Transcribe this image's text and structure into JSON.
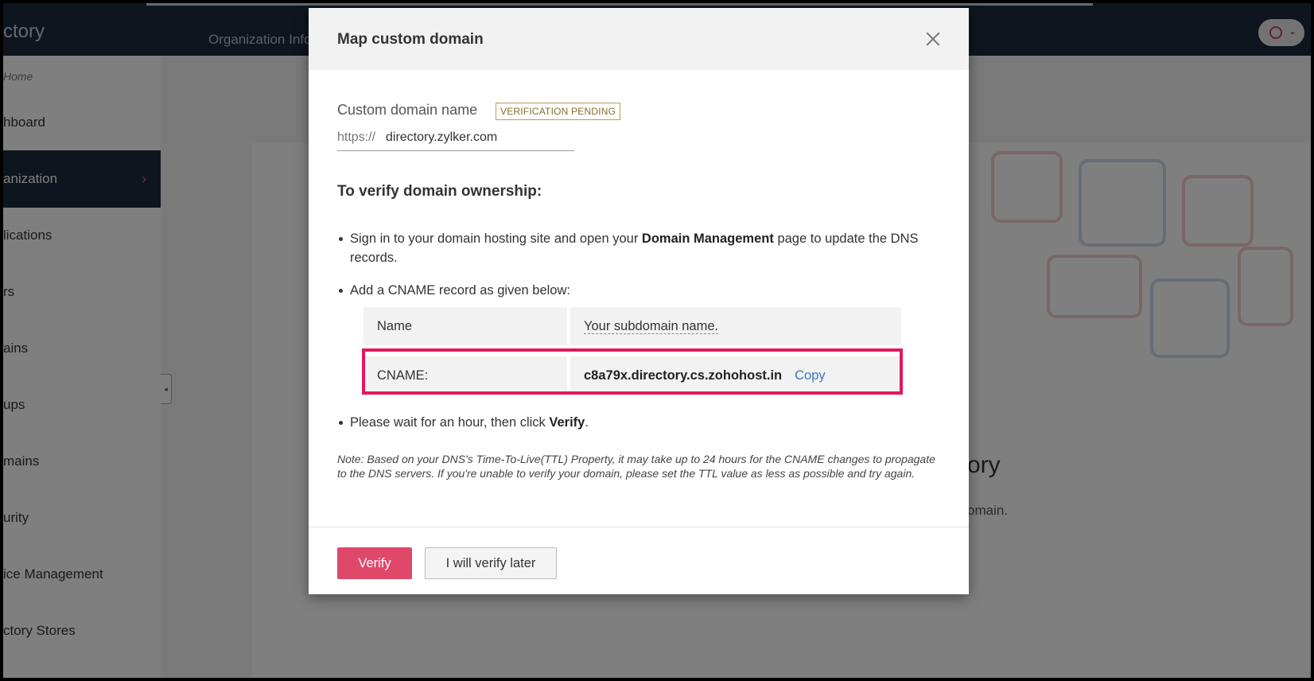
{
  "app": {
    "brand_fragment": "ctory",
    "top_nav_fragment": "Organization Info"
  },
  "sidebar": {
    "breadcrumb_fragment": "Home",
    "items": [
      {
        "label": "hboard"
      },
      {
        "label": "anization",
        "active": true
      },
      {
        "label": "lications"
      },
      {
        "label": "rs"
      },
      {
        "label": "ains"
      },
      {
        "label": "ups"
      },
      {
        "label": "mains"
      },
      {
        "label": "urity"
      },
      {
        "label": "ice Management"
      },
      {
        "label": "ctory Stores"
      }
    ]
  },
  "background_content": {
    "title_fragment": "ory",
    "desc_fragment": "omain."
  },
  "modal": {
    "title": "Map custom domain",
    "domain_label": "Custom domain name",
    "status_badge": "VERIFICATION PENDING",
    "url_prefix": "https://",
    "url_value": "directory.zylker.com",
    "verify_heading": "To verify domain ownership:",
    "step1_pre": "Sign in to your domain hosting site and open your ",
    "step1_bold": "Domain Management",
    "step1_post": " page to update the DNS",
    "step1_line2": "records.",
    "step2": "Add a CNAME record as given below:",
    "table": {
      "row1_label": "Name",
      "row1_value": "Your subdomain name.",
      "row2_label": "CNAME:",
      "row2_value": "c8a79x.directory.cs.zohohost.in",
      "copy_label": "Copy"
    },
    "step3_pre": "Please wait for an hour, then click ",
    "step3_bold": "Verify",
    "step3_post": ".",
    "note": "Note: Based on your DNS's Time-To-Live(TTL) Property, it may take up to 24 hours for the CNAME changes to propagate to the DNS servers. If you're unable to verify your domain, please set the TTL value as less as possible and try again.",
    "verify_button": "Verify",
    "later_button": "I will verify later"
  },
  "colors": {
    "primary_button": "#e0486a",
    "highlight_border": "#e0195a",
    "link": "#3a78c3",
    "topbar": "#1f2b3d"
  }
}
